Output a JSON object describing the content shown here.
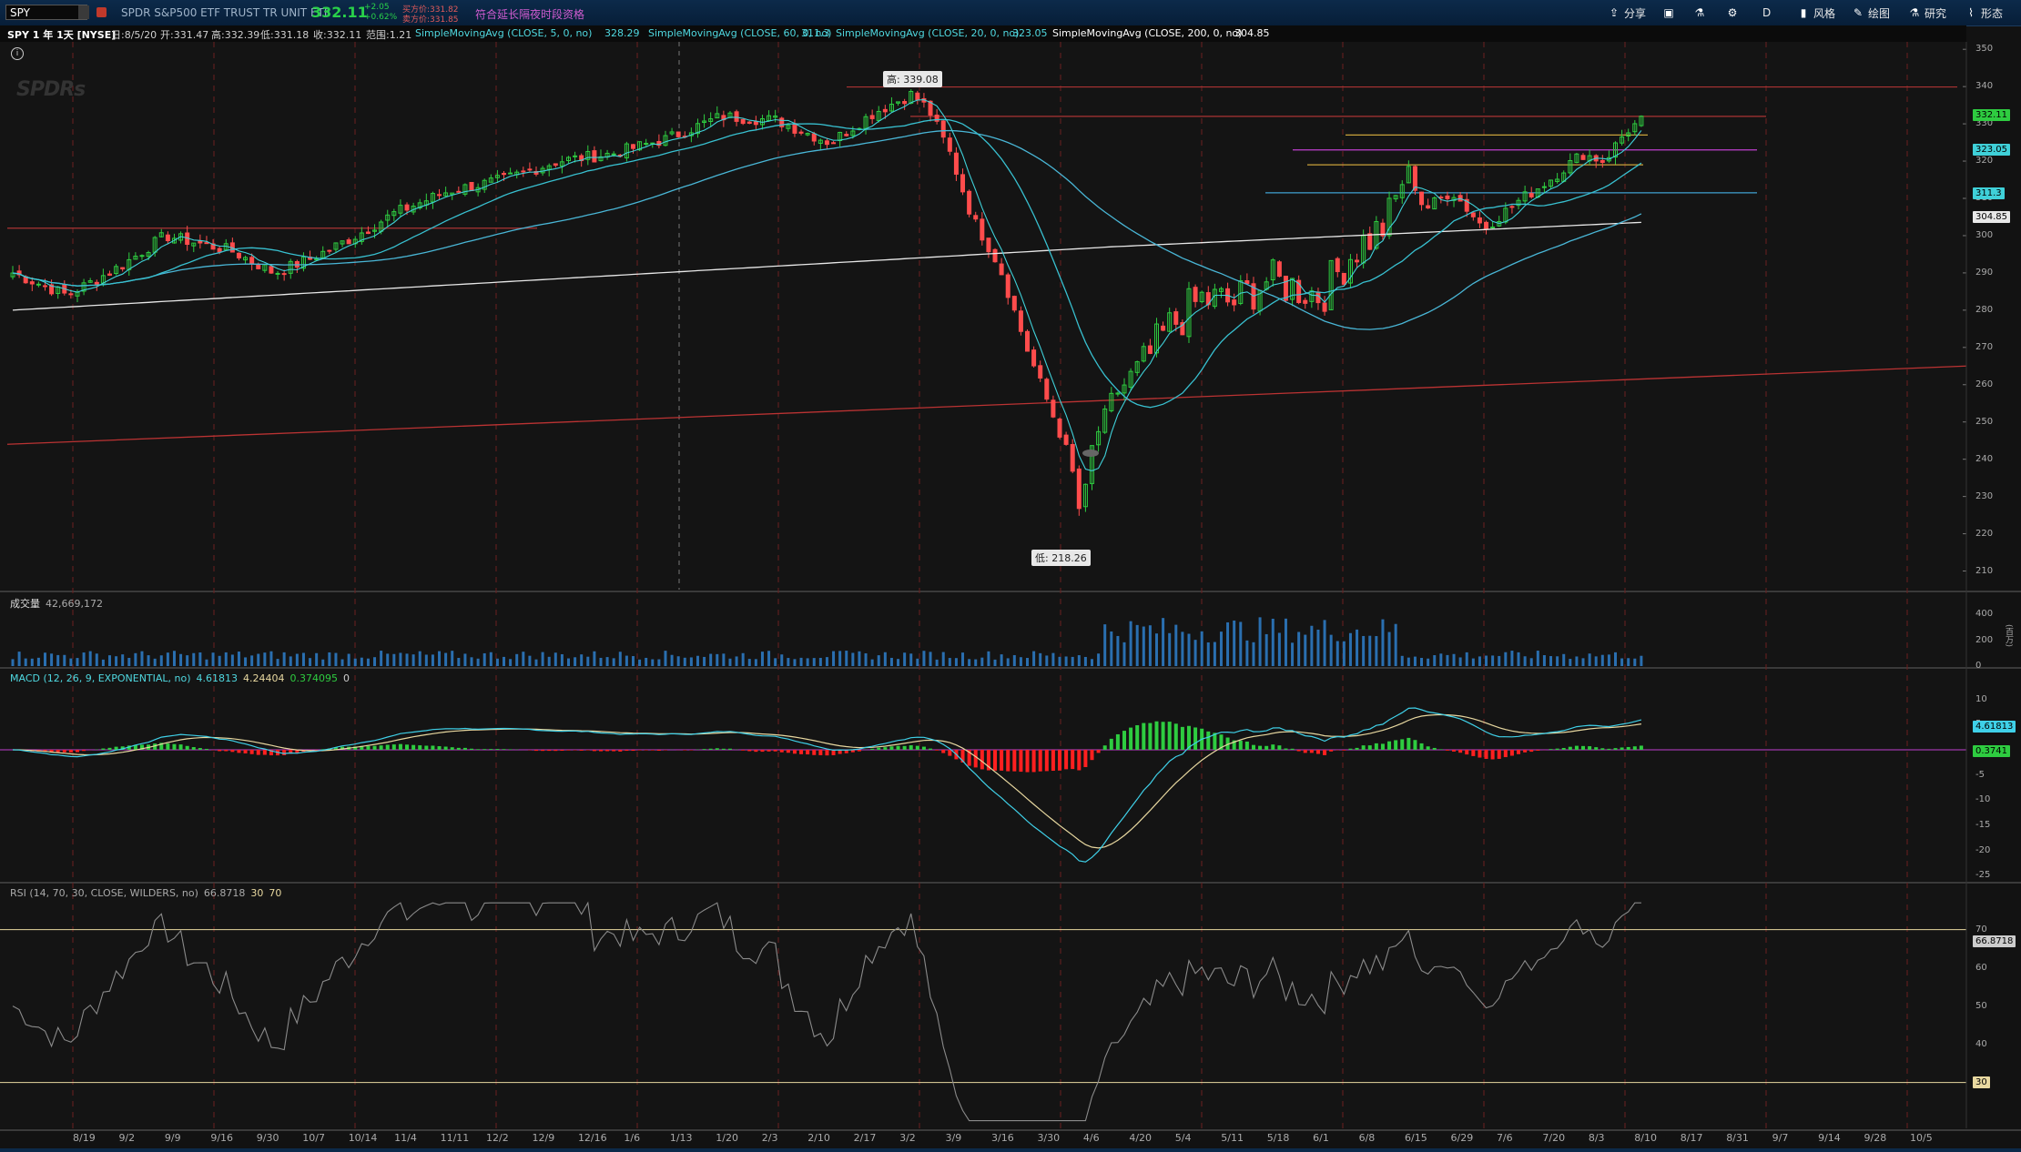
{
  "toolbar": {
    "symbol": "SPY",
    "description": "SPDR S&P500 ETF TRUST TR UNIT ETF",
    "last_price": "332.11",
    "change_abs": "+2.05",
    "change_pct": "+0.62%",
    "bid": "买方价:331.82",
    "ask": "卖方价:331.85",
    "extended_hours": "符合延长隔夜时段资格",
    "buttons": {
      "share": "分享",
      "period": "D",
      "style": "风格",
      "drawing": "绘图",
      "studies": "研究",
      "patterns": "形态"
    }
  },
  "infobar": {
    "title": "SPY 1 年 1天 [NYSE]",
    "date": "日:8/5/20",
    "open": "开:331.47",
    "high": "高:332.39",
    "low": "低:331.18",
    "close": "收:332.11",
    "range": "范围:1.21",
    "sma5": "SimpleMovingAvg (CLOSE, 5, 0, no)",
    "sma5_v": "328.29",
    "sma60": "SimpleMovingAvg (CLOSE, 60, 0, no)",
    "sma60_v": "311.3",
    "sma20": "SimpleMovingAvg (CLOSE, 20, 0, no)",
    "sma20_v": "323.05",
    "sma200": "SimpleMovingAvg (CLOSE, 200, 0, no)",
    "sma200_v": "304.85"
  },
  "watermark": "SPDRs",
  "price_pane": {
    "high_callout": "高: 339.08",
    "low_callout": "低: 218.26",
    "y_ticks": [
      "350",
      "340",
      "330",
      "320",
      "310",
      "300",
      "290",
      "280",
      "270",
      "260",
      "250",
      "240",
      "230",
      "220",
      "210"
    ],
    "badges": {
      "last": "332.11",
      "sma20": "323.05",
      "sma60": "311.3",
      "sma200": "304.85"
    }
  },
  "volume_pane": {
    "label": "成交量",
    "value": "42,669,172",
    "y_ticks": [
      "400",
      "200",
      "0"
    ],
    "unit": "(百万)"
  },
  "macd_pane": {
    "label": "MACD (12, 26, 9, EXPONENTIAL, no)",
    "value": "4.61813",
    "avg": "4.24404",
    "diff": "0.374095",
    "zero": "0",
    "y_ticks": [
      "10",
      "5",
      "0",
      "-5",
      "-10",
      "-15",
      "-20",
      "-25"
    ],
    "badges": {
      "value": "4.61813",
      "diff": "0.3741"
    }
  },
  "rsi_pane": {
    "label": "RSI (14, 70, 30, CLOSE, WILDERS, no)",
    "value": "66.8718",
    "os": "30",
    "ob": "70",
    "y_ticks": [
      "70",
      "60",
      "50",
      "40",
      "30"
    ],
    "badges": {
      "value": "66.8718",
      "os": "30"
    }
  },
  "x_axis": [
    "8/19",
    "9/2",
    "9/9",
    "9/16",
    "9/30",
    "10/7",
    "10/14",
    "11/4",
    "11/11",
    "12/2",
    "12/9",
    "12/16",
    "1/6",
    "1/13",
    "1/20",
    "2/3",
    "2/10",
    "2/17",
    "3/2",
    "3/9",
    "3/16",
    "3/30",
    "4/6",
    "4/20",
    "5/4",
    "5/11",
    "5/18",
    "6/1",
    "6/8",
    "6/15",
    "6/29",
    "7/6",
    "7/20",
    "8/3",
    "8/10",
    "8/17",
    "8/31",
    "9/7",
    "9/14",
    "9/28",
    "10/5"
  ],
  "colors": {
    "up": "#2ecc40",
    "down": "#ff4c4c",
    "sma5": "#3fd0d8",
    "sma20": "#38c0d0",
    "sma60": "#49b6d6",
    "sma200": "#e8e8e8",
    "macd": "#3fd0e8",
    "macd_avg": "#e8d8a0"
  }
}
